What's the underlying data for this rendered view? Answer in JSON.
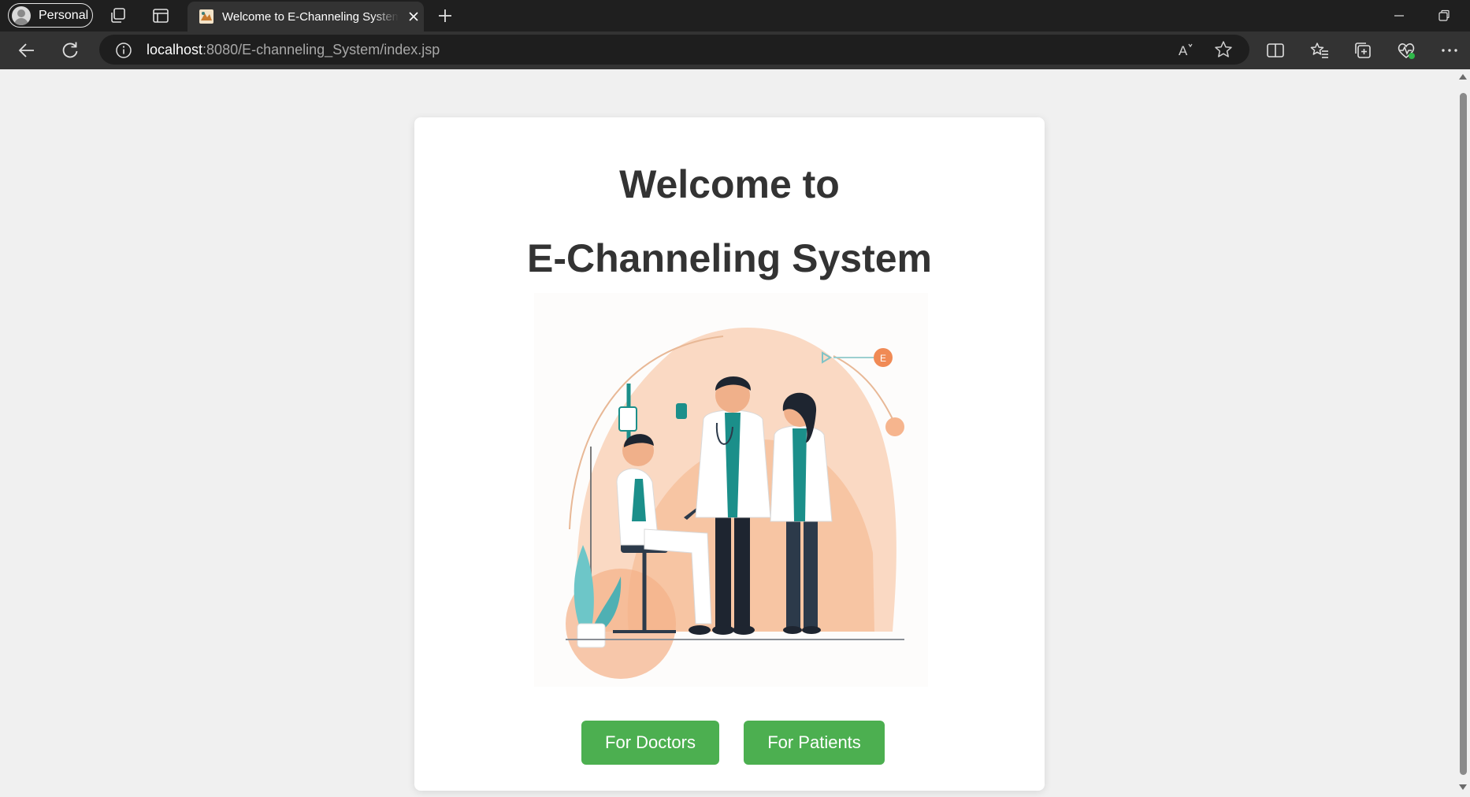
{
  "browser": {
    "profile_label": "Personal",
    "tab_title": "Welcome to E-Channeling System",
    "url_host": "localhost",
    "url_rest": ":8080/E-channeling_System/index.jsp",
    "read_aloud_label": "A"
  },
  "page": {
    "title_line1": "Welcome to",
    "title_line2": "E-Channeling System",
    "illustration_badge": "E",
    "buttons": {
      "doctors": "For Doctors",
      "patients": "For Patients"
    }
  },
  "colors": {
    "accent_green": "#4caf50",
    "title_text": "#333333",
    "illustration_peach": "#f6c3a3",
    "illustration_teal": "#1b8f8a"
  },
  "icons": [
    "workspaces-icon",
    "tab-actions-icon",
    "new-tab-icon",
    "back-icon",
    "refresh-icon",
    "info-icon",
    "read-aloud-icon",
    "favorite-star-icon",
    "split-screen-icon",
    "favorites-icon",
    "collections-icon",
    "browser-essentials-icon",
    "more-menu-icon",
    "minimize-icon",
    "restore-icon"
  ]
}
